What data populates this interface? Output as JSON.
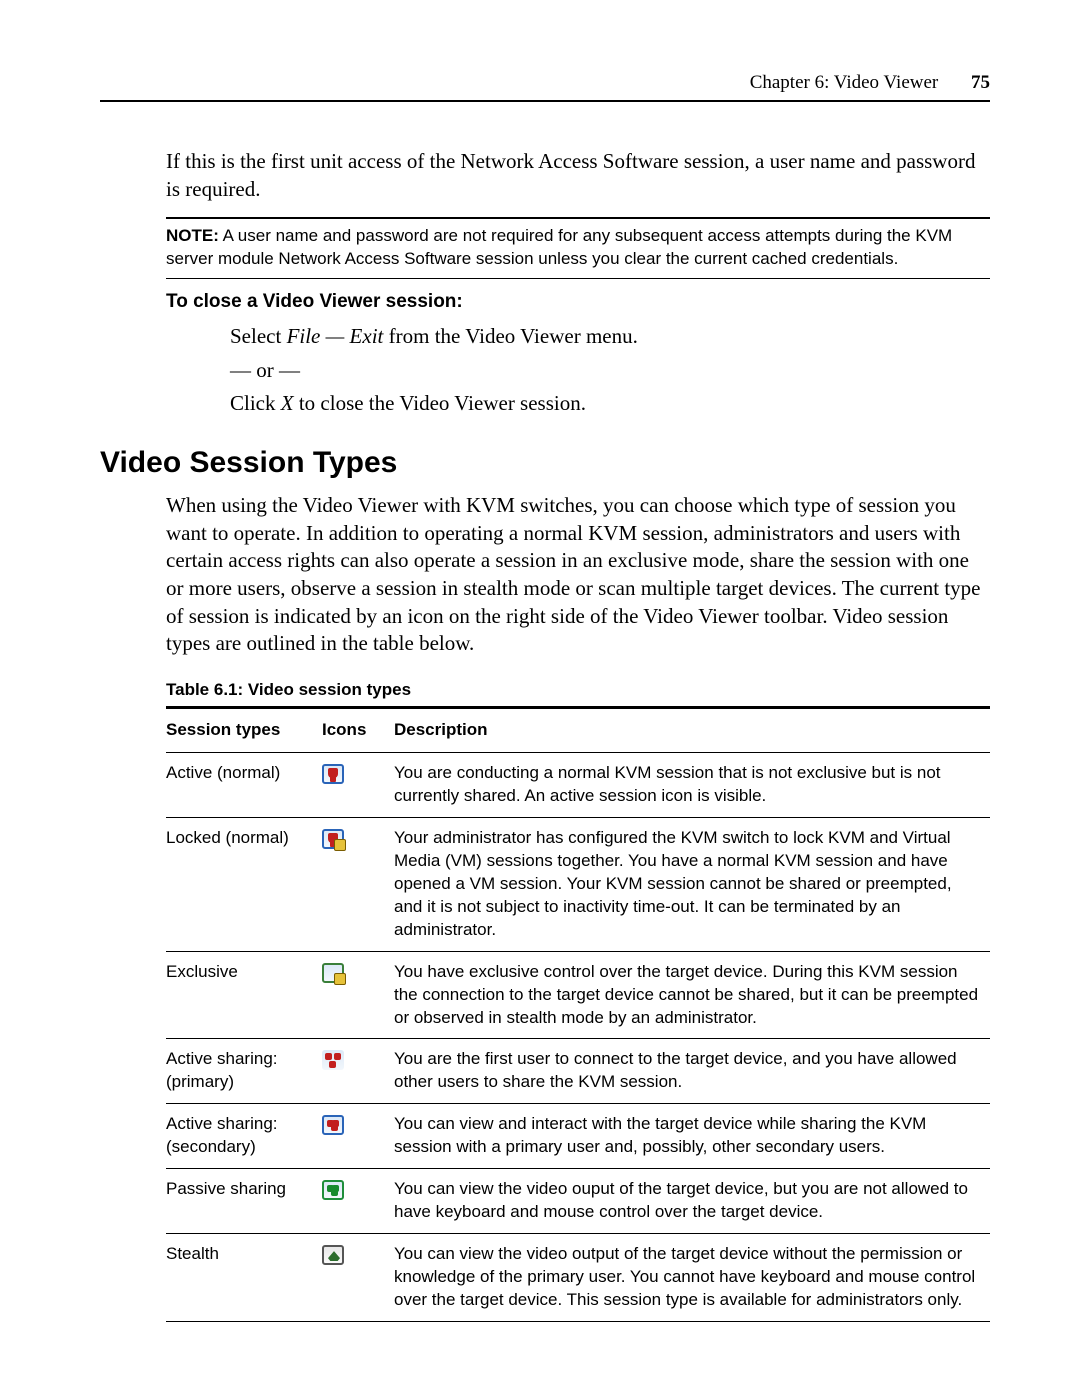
{
  "header": {
    "chapter": "Chapter 6: Video Viewer",
    "page": "75"
  },
  "intro": "If this is the first unit access of the Network Access Software session, a user name and password is required.",
  "note": {
    "label": "NOTE:",
    "text": " A user name and password are not required for any subsequent access attempts during the KVM server module Network Access Software session unless you clear the current cached credentials."
  },
  "task": {
    "title": "To close a Video Viewer session:",
    "step1_prefix": "Select ",
    "step1_em": "File — Exit",
    "step1_suffix": " from the Video Viewer menu.",
    "or": "— or —",
    "step2_prefix": "Click ",
    "step2_em": "X",
    "step2_suffix": " to close the Video Viewer session."
  },
  "section": {
    "title": "Video Session Types",
    "para": "When using the Video Viewer with KVM switches, you can choose which type of session you want to operate. In addition to operating a normal KVM session, administrators and users with certain access rights can also operate a session in an exclusive mode, share the session with one or more users, observe a session in stealth mode or scan multiple target devices. The current type of session is indicated by an icon on the right side of the Video Viewer toolbar. Video session types are outlined in the table below."
  },
  "table": {
    "caption": "Table 6.1: Video session types",
    "headers": {
      "c1": "Session types",
      "c2": "Icons",
      "c3": "Description"
    },
    "rows": [
      {
        "type": "Active (normal)",
        "icon": "active-normal-icon",
        "desc": "You are conducting a normal KVM session that is not exclusive but is not currently shared. An active session icon is visible."
      },
      {
        "type": "Locked (normal)",
        "icon": "locked-normal-icon",
        "desc": "Your administrator has configured the KVM switch to lock KVM and Virtual Media (VM) sessions together. You have a normal KVM session and have opened a VM session. Your KVM session cannot be shared or preempted, and it is not subject to inactivity time-out. It can be terminated by an administrator."
      },
      {
        "type": "Exclusive",
        "icon": "exclusive-icon",
        "desc": "You have exclusive control over the target device. During this KVM session the connection to the target device cannot be shared, but it can be preempted or observed in stealth mode by an administrator."
      },
      {
        "type": "Active sharing: (primary)",
        "icon": "active-sharing-primary-icon",
        "desc": "You are the first user to connect to the target device, and you have allowed other users to share the KVM session."
      },
      {
        "type": "Active sharing: (secondary)",
        "icon": "active-sharing-secondary-icon",
        "desc": "You can view and interact with the target device while sharing the KVM session with a primary user and, possibly, other secondary users."
      },
      {
        "type": "Passive sharing",
        "icon": "passive-sharing-icon",
        "desc": "You can view the video ouput of the target device, but you are not allowed to have keyboard and mouse control over the target device."
      },
      {
        "type": "Stealth",
        "icon": "stealth-icon",
        "desc": "You can view the video output of the target device without the permission or knowledge of the primary user. You cannot have keyboard and mouse control over the target device. This session type is available for administrators only."
      }
    ]
  }
}
